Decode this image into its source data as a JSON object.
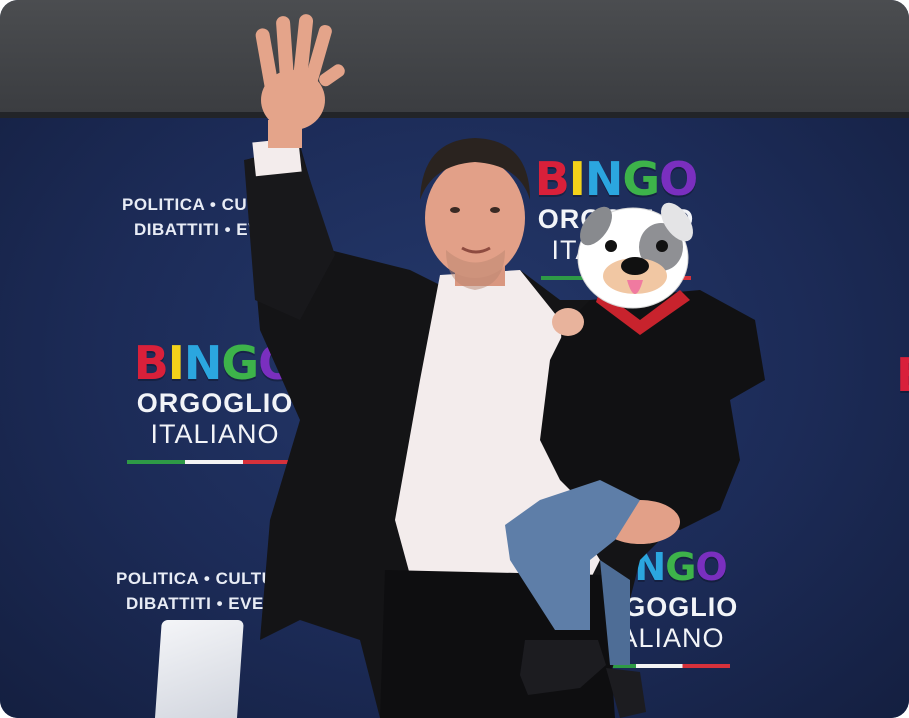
{
  "banner": {
    "tagline_line1": "POLITICA • CULTURA",
    "tagline_line2": "DIBATTITI • EVENTI",
    "bingo_letters": [
      {
        "char": "B",
        "color": "#d9203a"
      },
      {
        "char": "I",
        "color": "#f3d21a"
      },
      {
        "char": "N",
        "color": "#2ba6df"
      },
      {
        "char": "G",
        "color": "#3db34a"
      },
      {
        "char": "O",
        "color": "#7a2fbf"
      }
    ],
    "logo_line1": "ORGOGLIO",
    "logo_line2": "ITALIANO",
    "flag_colors": [
      "#2e9a46",
      "#f4f4f4",
      "#d6313b"
    ]
  },
  "overlay": {
    "sticker": "cartoon-dog-face-sticker"
  }
}
